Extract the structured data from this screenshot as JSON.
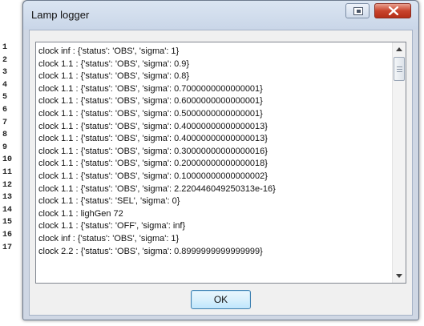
{
  "window": {
    "title": "Lamp logger",
    "ok_label": "OK"
  },
  "line_numbers": [
    "1",
    "2",
    "3",
    "4",
    "5",
    "6",
    "7",
    "8",
    "9",
    "10",
    "11",
    "12",
    "13",
    "14",
    "15",
    "16",
    "17"
  ],
  "log": [
    "clock inf : {'status': 'OBS', 'sigma': 1}",
    "clock 1.1 : {'status': 'OBS', 'sigma': 0.9}",
    "clock 1.1 : {'status': 'OBS', 'sigma': 0.8}",
    "clock 1.1 : {'status': 'OBS', 'sigma': 0.7000000000000001}",
    "clock 1.1 : {'status': 'OBS', 'sigma': 0.6000000000000001}",
    "clock 1.1 : {'status': 'OBS', 'sigma': 0.5000000000000001}",
    "clock 1.1 : {'status': 'OBS', 'sigma': 0.40000000000000013}",
    "clock 1.1 : {'status': 'OBS', 'sigma': 0.40000000000000013}",
    "clock 1.1 : {'status': 'OBS', 'sigma': 0.30000000000000016}",
    "clock 1.1 : {'status': 'OBS', 'sigma': 0.20000000000000018}",
    "clock 1.1 : {'status': 'OBS', 'sigma': 0.10000000000000002}",
    "clock 1.1 : {'status': 'OBS', 'sigma': 2.220446049250313e-16}",
    "clock 1.1 : {'status': 'SEL', 'sigma': 0}",
    "clock 1.1 : lighGen 72",
    "clock 1.1 : {'status': 'OFF', 'sigma': inf}",
    "clock inf : {'status': 'OBS', 'sigma': 1}",
    "clock 2.2 : {'status': 'OBS', 'sigma': 0.8999999999999999}"
  ],
  "icons": {
    "restore": "restore-icon",
    "close": "close-icon",
    "scroll_up": "scroll-up-arrow-icon",
    "scroll_down": "scroll-down-arrow-icon"
  },
  "colors": {
    "close_button": "#c8442d",
    "ok_border": "#3c7fb1",
    "window_frame": "#cfd7e4"
  }
}
